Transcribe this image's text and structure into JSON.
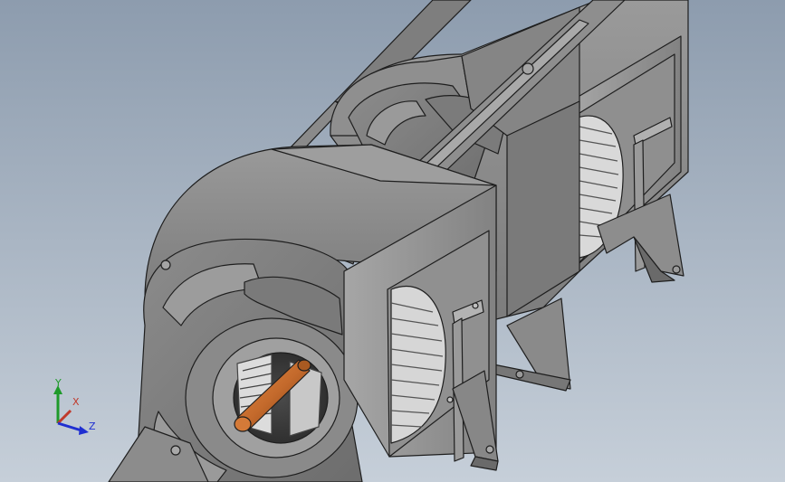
{
  "viewport": {
    "background_top": "#8d9cae",
    "background_bottom": "#c6cfd9"
  },
  "model": {
    "housing_color": "#8a8a8a",
    "housing_dark": "#5e5e5e",
    "housing_light": "#a8a8a8",
    "edge_color": "#1e1e1e",
    "shaft_color": "#c46a2c",
    "wheel_blade_color": "#d8d8d8"
  },
  "triad": {
    "labels": {
      "y": "Y",
      "x": "X",
      "z": "Z"
    },
    "colors": {
      "y": "#1e9a2a",
      "x": "#c0392b",
      "z": "#1f2fd1"
    }
  }
}
